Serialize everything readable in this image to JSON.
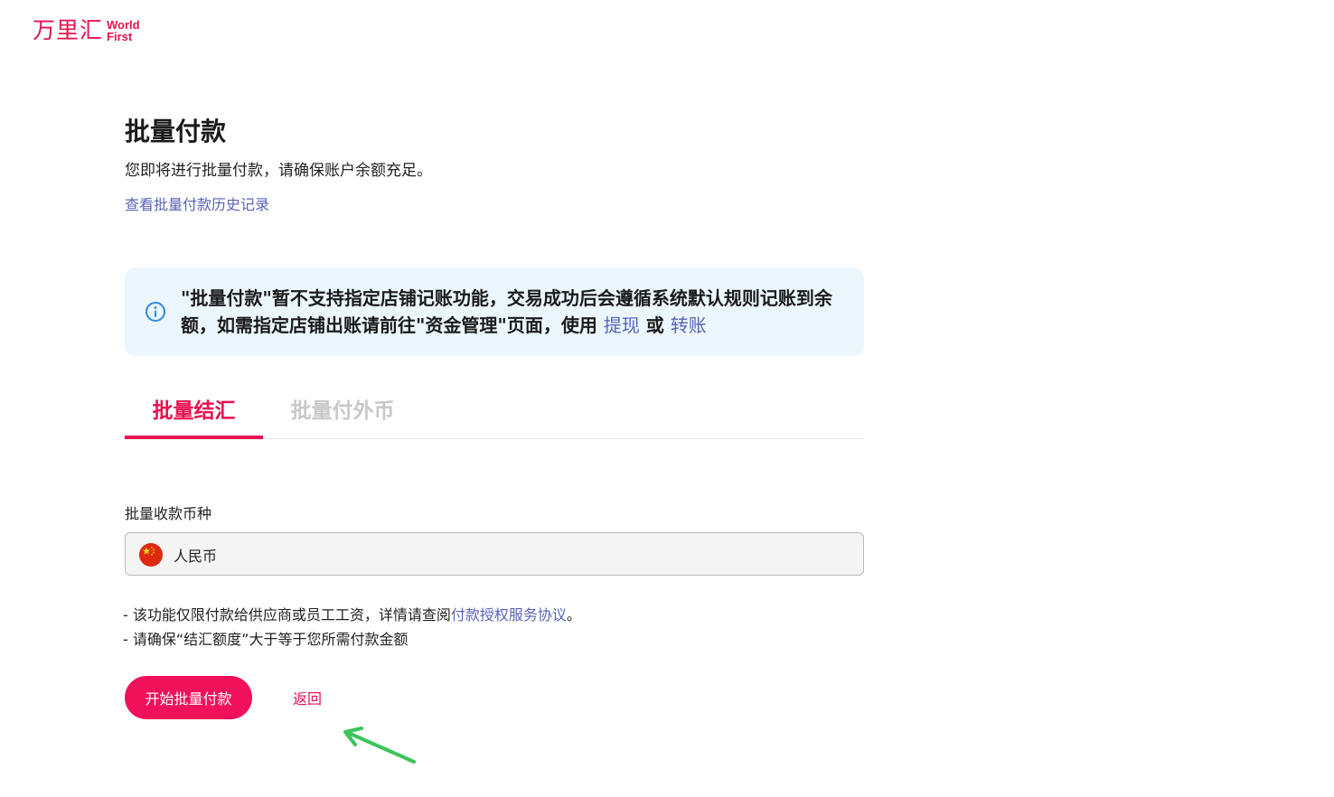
{
  "brand": {
    "cn": "万里汇",
    "en_line1": "World",
    "en_line2": "First"
  },
  "page": {
    "title": "批量付款",
    "subtitle": "您即将进行批量付款，请确保账户余额充足。",
    "history_link": "查看批量付款历史记录"
  },
  "notice": {
    "icon": "info-icon",
    "text": "\"批量付款\"暂不支持指定店铺记账功能，交易成功后会遵循系统默认规则记账到余额，如需指定店铺出账请前往\"资金管理\"页面，使用 ",
    "link_withdraw": "提现",
    "or": " 或 ",
    "link_transfer": "转账"
  },
  "tabs": [
    {
      "label": "批量结汇",
      "active": true
    },
    {
      "label": "批量付外币",
      "active": false
    }
  ],
  "currency": {
    "label": "批量收款币种",
    "value": "人民币",
    "flag_icon": "china-flag-icon"
  },
  "notes": {
    "line1_prefix": "- 该功能仅限付款给供应商或员工工资，详情请查阅",
    "line1_link": "付款授权服务协议",
    "line1_suffix": "。",
    "line2": "- 请确保“结汇额度”大于等于您所需付款金额"
  },
  "actions": {
    "start": "开始批量付款",
    "back": "返回"
  },
  "colors": {
    "brand": "#e8124f",
    "link": "#5a62b8",
    "notice_bg": "#ebf6fd",
    "annotation_arrow": "#3cc45a"
  }
}
